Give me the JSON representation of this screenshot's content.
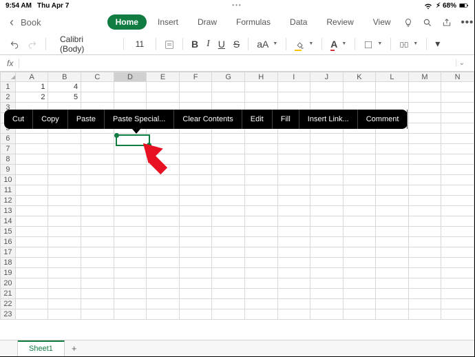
{
  "status": {
    "time": "9:54 AM",
    "date": "Thu Apr 7",
    "battery": "68%",
    "wifi": "􀙇"
  },
  "doc": {
    "title": "Book"
  },
  "tabs": {
    "home": "Home",
    "insert": "Insert",
    "draw": "Draw",
    "formulas": "Formulas",
    "data": "Data",
    "review": "Review",
    "view": "View"
  },
  "toolbar": {
    "font": "Calibri (Body)",
    "size": "11"
  },
  "formula": {
    "fx": "fx"
  },
  "cells": {
    "A1": "1",
    "A2": "2",
    "A3": "",
    "B1": "4",
    "B2": "5",
    "B3": ""
  },
  "columns": [
    "A",
    "B",
    "C",
    "D",
    "E",
    "F",
    "G",
    "H",
    "I",
    "J",
    "K",
    "L",
    "M",
    "N"
  ],
  "selected_col": "D",
  "context": {
    "cut": "Cut",
    "copy": "Copy",
    "paste": "Paste",
    "paste_special": "Paste Special...",
    "clear": "Clear Contents",
    "edit": "Edit",
    "fill": "Fill",
    "insert_link": "Insert Link...",
    "comment": "Comment"
  },
  "sheets": {
    "sheet1": "Sheet1",
    "add": "+"
  }
}
